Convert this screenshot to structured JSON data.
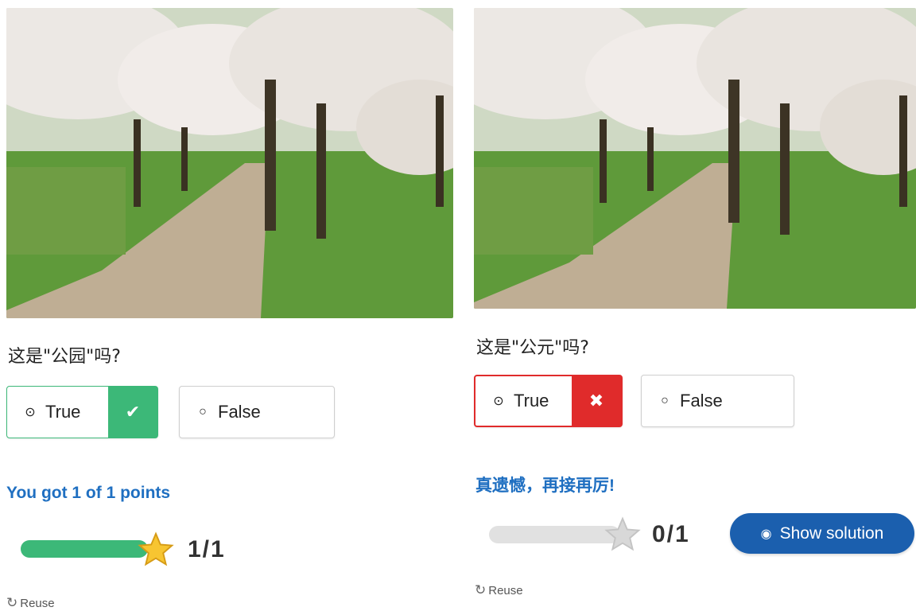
{
  "left": {
    "question": "这是\"公园\"吗?",
    "options": [
      {
        "label": "True",
        "radio": "⊙",
        "state": "selected-correct",
        "mark": "✔"
      },
      {
        "label": "False",
        "radio": "○",
        "state": "unselected"
      }
    ],
    "feedback": "You got 1 of 1 points",
    "progress": {
      "fraction": 1.0
    },
    "score_text": "1/1",
    "reuse_label": "Reuse"
  },
  "right": {
    "question": "这是\"公元\"吗?",
    "options": [
      {
        "label": "True",
        "radio": "⊙",
        "state": "selected-wrong",
        "mark": "✖"
      },
      {
        "label": "False",
        "radio": "○",
        "state": "unselected"
      }
    ],
    "feedback": "真遗憾，再接再厉!",
    "progress": {
      "fraction": 0.0
    },
    "score_text": "0/1",
    "show_solution_label": "Show solution",
    "reuse_label": "Reuse"
  },
  "colors": {
    "correct_green": "#3cb878",
    "wrong_red": "#e02b2b",
    "accent_blue": "#1b5fae",
    "feedback_blue": "#1f6fc1",
    "star_gold": "#f7c531",
    "star_grey": "#d8d8d8"
  },
  "icons": {
    "radio_selected": "radio-selected-icon",
    "radio_empty": "radio-empty-icon",
    "check": "check-icon",
    "cross": "cross-icon",
    "star": "star-icon",
    "eye": "eye-icon",
    "reuse": "reuse-icon"
  }
}
